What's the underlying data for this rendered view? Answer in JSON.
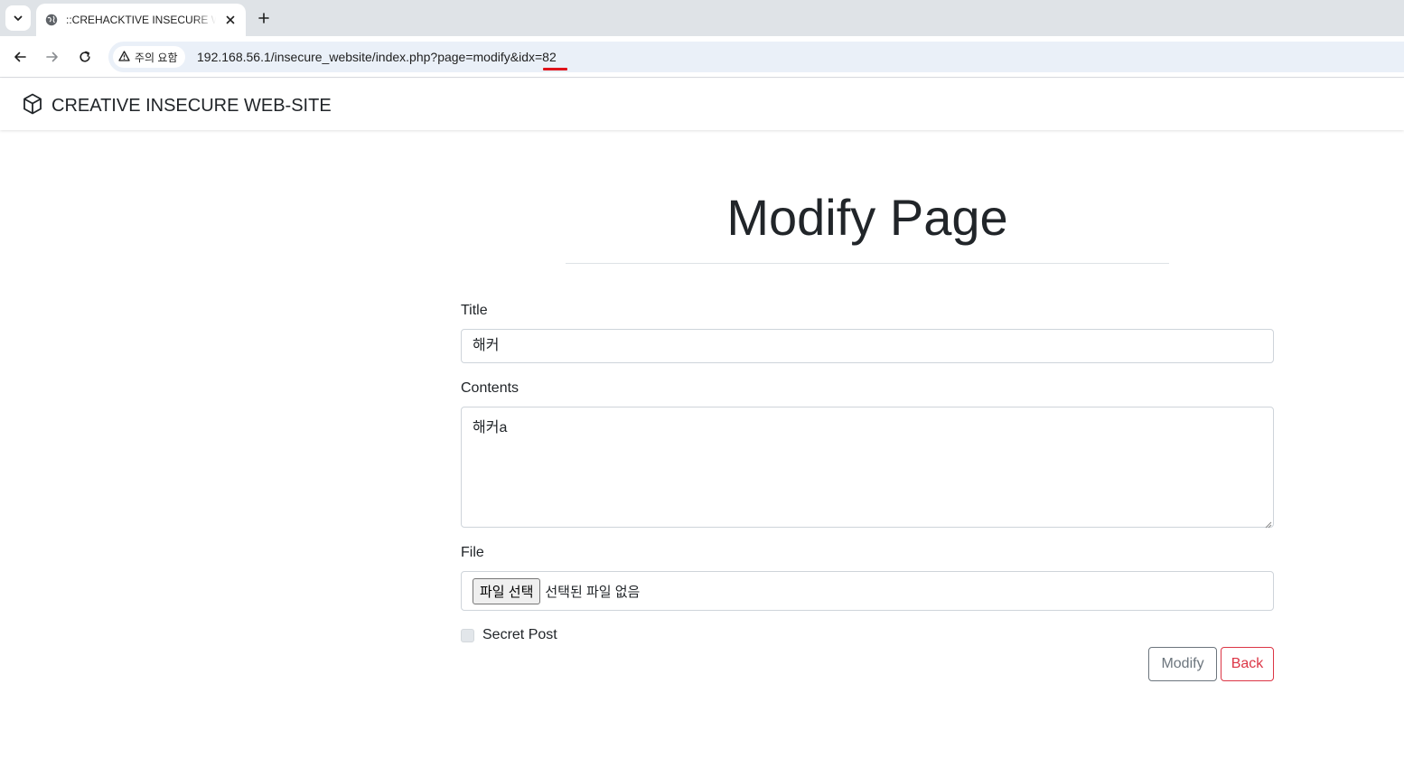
{
  "browser": {
    "tab": {
      "title": "::CREHACKTIVE INSECURE WEB-SITE::"
    },
    "address_bar": {
      "security_label": "주의 요함",
      "url": "192.168.56.1/insecure_website/index.php?page=modify&idx=82",
      "highlight_color": "#e0131a"
    },
    "icons": [
      "tab-list-icon",
      "globe-icon",
      "close-icon",
      "plus-icon",
      "back-arrow-icon",
      "forward-arrow-icon",
      "reload-icon",
      "warning-icon"
    ]
  },
  "site": {
    "brand": "CREATIVE INSECURE WEB-SITE",
    "brand_icon": "box-icon"
  },
  "form": {
    "heading": "Modify Page",
    "title_label": "Title",
    "title_value": "해커",
    "contents_label": "Contents",
    "contents_value": "해커a",
    "file_label": "File",
    "file_button": "파일 선택",
    "file_status": "선택된 파일 없음",
    "secret_label": "Secret Post",
    "secret_checked": false,
    "modify_button": "Modify",
    "back_button": "Back"
  },
  "colors": {
    "modify_border": "#6c757d",
    "back_border": "#dc3545"
  }
}
